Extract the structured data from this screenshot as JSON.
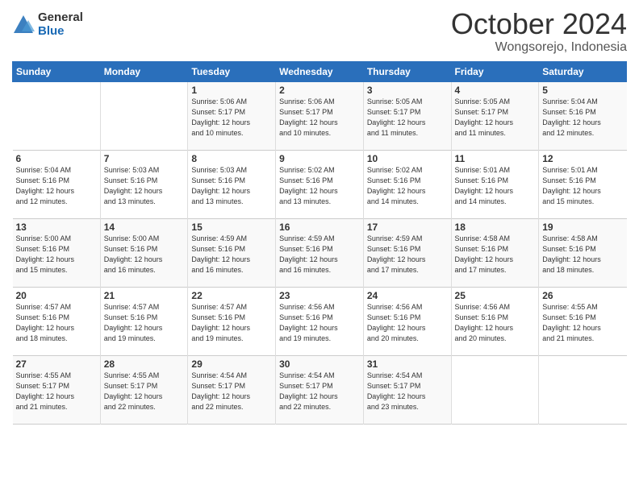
{
  "header": {
    "logo_general": "General",
    "logo_blue": "Blue",
    "month_title": "October 2024",
    "location": "Wongsorejo, Indonesia"
  },
  "weekdays": [
    "Sunday",
    "Monday",
    "Tuesday",
    "Wednesday",
    "Thursday",
    "Friday",
    "Saturday"
  ],
  "weeks": [
    [
      {
        "day": "",
        "info": ""
      },
      {
        "day": "",
        "info": ""
      },
      {
        "day": "1",
        "info": "Sunrise: 5:06 AM\nSunset: 5:17 PM\nDaylight: 12 hours\nand 10 minutes."
      },
      {
        "day": "2",
        "info": "Sunrise: 5:06 AM\nSunset: 5:17 PM\nDaylight: 12 hours\nand 10 minutes."
      },
      {
        "day": "3",
        "info": "Sunrise: 5:05 AM\nSunset: 5:17 PM\nDaylight: 12 hours\nand 11 minutes."
      },
      {
        "day": "4",
        "info": "Sunrise: 5:05 AM\nSunset: 5:17 PM\nDaylight: 12 hours\nand 11 minutes."
      },
      {
        "day": "5",
        "info": "Sunrise: 5:04 AM\nSunset: 5:16 PM\nDaylight: 12 hours\nand 12 minutes."
      }
    ],
    [
      {
        "day": "6",
        "info": "Sunrise: 5:04 AM\nSunset: 5:16 PM\nDaylight: 12 hours\nand 12 minutes."
      },
      {
        "day": "7",
        "info": "Sunrise: 5:03 AM\nSunset: 5:16 PM\nDaylight: 12 hours\nand 13 minutes."
      },
      {
        "day": "8",
        "info": "Sunrise: 5:03 AM\nSunset: 5:16 PM\nDaylight: 12 hours\nand 13 minutes."
      },
      {
        "day": "9",
        "info": "Sunrise: 5:02 AM\nSunset: 5:16 PM\nDaylight: 12 hours\nand 13 minutes."
      },
      {
        "day": "10",
        "info": "Sunrise: 5:02 AM\nSunset: 5:16 PM\nDaylight: 12 hours\nand 14 minutes."
      },
      {
        "day": "11",
        "info": "Sunrise: 5:01 AM\nSunset: 5:16 PM\nDaylight: 12 hours\nand 14 minutes."
      },
      {
        "day": "12",
        "info": "Sunrise: 5:01 AM\nSunset: 5:16 PM\nDaylight: 12 hours\nand 15 minutes."
      }
    ],
    [
      {
        "day": "13",
        "info": "Sunrise: 5:00 AM\nSunset: 5:16 PM\nDaylight: 12 hours\nand 15 minutes."
      },
      {
        "day": "14",
        "info": "Sunrise: 5:00 AM\nSunset: 5:16 PM\nDaylight: 12 hours\nand 16 minutes."
      },
      {
        "day": "15",
        "info": "Sunrise: 4:59 AM\nSunset: 5:16 PM\nDaylight: 12 hours\nand 16 minutes."
      },
      {
        "day": "16",
        "info": "Sunrise: 4:59 AM\nSunset: 5:16 PM\nDaylight: 12 hours\nand 16 minutes."
      },
      {
        "day": "17",
        "info": "Sunrise: 4:59 AM\nSunset: 5:16 PM\nDaylight: 12 hours\nand 17 minutes."
      },
      {
        "day": "18",
        "info": "Sunrise: 4:58 AM\nSunset: 5:16 PM\nDaylight: 12 hours\nand 17 minutes."
      },
      {
        "day": "19",
        "info": "Sunrise: 4:58 AM\nSunset: 5:16 PM\nDaylight: 12 hours\nand 18 minutes."
      }
    ],
    [
      {
        "day": "20",
        "info": "Sunrise: 4:57 AM\nSunset: 5:16 PM\nDaylight: 12 hours\nand 18 minutes."
      },
      {
        "day": "21",
        "info": "Sunrise: 4:57 AM\nSunset: 5:16 PM\nDaylight: 12 hours\nand 19 minutes."
      },
      {
        "day": "22",
        "info": "Sunrise: 4:57 AM\nSunset: 5:16 PM\nDaylight: 12 hours\nand 19 minutes."
      },
      {
        "day": "23",
        "info": "Sunrise: 4:56 AM\nSunset: 5:16 PM\nDaylight: 12 hours\nand 19 minutes."
      },
      {
        "day": "24",
        "info": "Sunrise: 4:56 AM\nSunset: 5:16 PM\nDaylight: 12 hours\nand 20 minutes."
      },
      {
        "day": "25",
        "info": "Sunrise: 4:56 AM\nSunset: 5:16 PM\nDaylight: 12 hours\nand 20 minutes."
      },
      {
        "day": "26",
        "info": "Sunrise: 4:55 AM\nSunset: 5:16 PM\nDaylight: 12 hours\nand 21 minutes."
      }
    ],
    [
      {
        "day": "27",
        "info": "Sunrise: 4:55 AM\nSunset: 5:17 PM\nDaylight: 12 hours\nand 21 minutes."
      },
      {
        "day": "28",
        "info": "Sunrise: 4:55 AM\nSunset: 5:17 PM\nDaylight: 12 hours\nand 22 minutes."
      },
      {
        "day": "29",
        "info": "Sunrise: 4:54 AM\nSunset: 5:17 PM\nDaylight: 12 hours\nand 22 minutes."
      },
      {
        "day": "30",
        "info": "Sunrise: 4:54 AM\nSunset: 5:17 PM\nDaylight: 12 hours\nand 22 minutes."
      },
      {
        "day": "31",
        "info": "Sunrise: 4:54 AM\nSunset: 5:17 PM\nDaylight: 12 hours\nand 23 minutes."
      },
      {
        "day": "",
        "info": ""
      },
      {
        "day": "",
        "info": ""
      }
    ]
  ]
}
